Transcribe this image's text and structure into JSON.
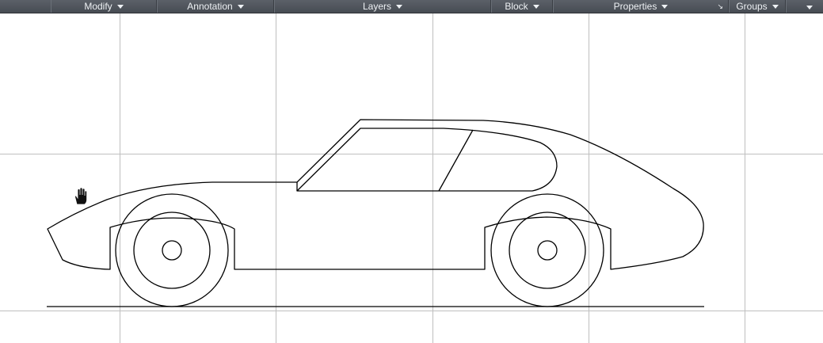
{
  "ribbon": {
    "panels": [
      {
        "label": "Modify"
      },
      {
        "label": "Annotation"
      },
      {
        "label": "Layers"
      },
      {
        "label": "Block"
      },
      {
        "label": "Properties",
        "launcher": "↘"
      },
      {
        "label": "Groups"
      }
    ],
    "dropdown_icon": "chevron-down-icon"
  },
  "drawing": {
    "subject": "car-side-profile",
    "line_color": "#000000",
    "grid_color": "#bfbfbf",
    "background": "#ffffff"
  },
  "cursor": {
    "icon": "pan-hand-icon"
  }
}
